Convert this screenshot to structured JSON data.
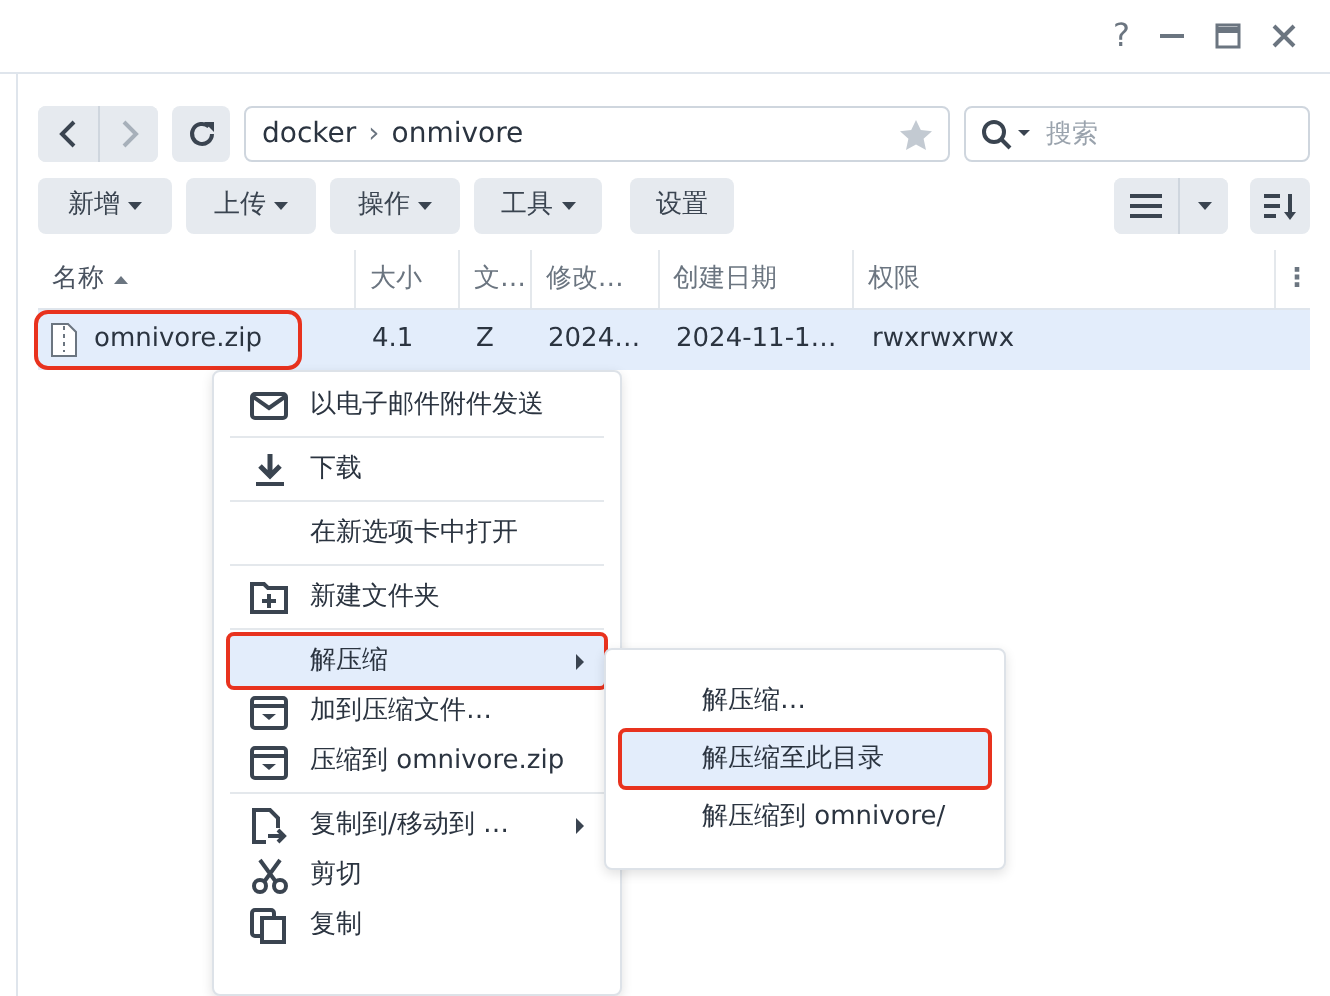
{
  "window": {
    "help_label": "?"
  },
  "location": {
    "segments": [
      "docker",
      "onmivore"
    ],
    "separator": "›"
  },
  "search": {
    "placeholder": "搜索"
  },
  "toolbar": [
    {
      "label": "新增",
      "has_menu": true
    },
    {
      "label": "上传",
      "has_menu": true
    },
    {
      "label": "操作",
      "has_menu": true
    },
    {
      "label": "工具",
      "has_menu": true
    },
    {
      "label": "设置",
      "has_menu": false
    }
  ],
  "table": {
    "more_label": "⋮",
    "columns": [
      {
        "label": "名称",
        "sorted": true
      },
      {
        "label": "大小",
        "sorted": false
      },
      {
        "label": "文…",
        "sorted": false
      },
      {
        "label": "修改…",
        "sorted": false
      },
      {
        "label": "创建日期",
        "sorted": false
      },
      {
        "label": "权限",
        "sorted": false
      }
    ],
    "rows": [
      {
        "cells": [
          "omnivore.zip",
          "4.1",
          "Z",
          "2024…",
          "2024-11-1…",
          "rwxrwxrwx"
        ],
        "selected": true,
        "marked": true
      }
    ]
  },
  "context_menu": {
    "items": [
      {
        "kind": "item",
        "label": "以电子邮件附件发送",
        "submenu": false,
        "selected": false,
        "marked": false
      },
      {
        "kind": "divider"
      },
      {
        "kind": "item",
        "label": "下载",
        "submenu": false,
        "selected": false,
        "marked": false
      },
      {
        "kind": "divider"
      },
      {
        "kind": "item",
        "label": "在新选项卡中打开",
        "submenu": false,
        "selected": false,
        "marked": false
      },
      {
        "kind": "divider"
      },
      {
        "kind": "item",
        "label": "新建文件夹",
        "submenu": false,
        "selected": false,
        "marked": false
      },
      {
        "kind": "divider"
      },
      {
        "kind": "item",
        "label": "解压缩",
        "submenu": true,
        "selected": true,
        "marked": true
      },
      {
        "kind": "item",
        "label": "加到压缩文件…",
        "submenu": false,
        "selected": false,
        "marked": false
      },
      {
        "kind": "item",
        "label": "压缩到 omnivore.zip",
        "submenu": false,
        "selected": false,
        "marked": false
      },
      {
        "kind": "divider"
      },
      {
        "kind": "item",
        "label": "复制到/移动到 …",
        "submenu": true,
        "selected": false,
        "marked": false
      },
      {
        "kind": "item",
        "label": "剪切",
        "submenu": false,
        "selected": false,
        "marked": false
      },
      {
        "kind": "item",
        "label": "复制",
        "submenu": false,
        "selected": false,
        "marked": false
      }
    ]
  },
  "submenu": {
    "items": [
      {
        "label": "解压缩…",
        "selected": false,
        "marked": false
      },
      {
        "label": "解压缩至此目录",
        "selected": true,
        "marked": true
      },
      {
        "label": "解压缩到 omnivore/",
        "selected": false,
        "marked": false
      }
    ]
  }
}
